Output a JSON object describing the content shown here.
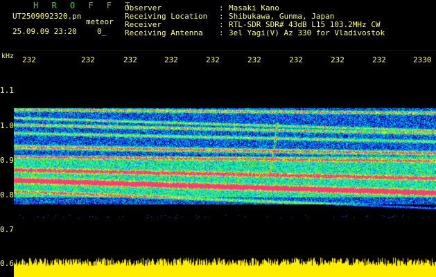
{
  "header": {
    "app_title": "H R O F F T",
    "file_name": "UT2509092320.pn",
    "mode": "meteor",
    "datetime": "25.09.09 23:20",
    "status_code": "0_",
    "fields": [
      {
        "label": "Observer",
        "value": "Masaki Kano"
      },
      {
        "label": "Receiving Location",
        "value": "Shibukawa, Gunma, Japan"
      },
      {
        "label": "Receiver",
        "value": "RTL-SDR SDR# 43dB L15 103.2MHz CW"
      },
      {
        "label": "Receiving Antenna",
        "value": "3el Yagi(V) Az 330 for Vladivostok"
      }
    ]
  },
  "time_axis": {
    "ticks": [
      "232",
      "232",
      "232",
      "232",
      "232",
      "232",
      "232",
      "232",
      "232",
      "2330"
    ]
  },
  "freq_axis": {
    "unit": "kHz",
    "labels": [
      "1.1",
      "1.0",
      "0.9",
      "0.8",
      "0.7",
      "0.6"
    ]
  },
  "colors": {
    "title": "#3cd23c",
    "text": "#ffff66",
    "signal_strong": "#ff3c78",
    "background": "#000000"
  }
}
